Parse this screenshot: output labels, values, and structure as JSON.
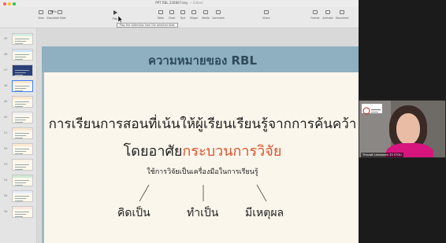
{
  "window": {
    "title": "PPT RBL 230807.key",
    "title_suffix": "— Edited"
  },
  "toolbar": {
    "buttons": [
      {
        "label": "View",
        "icon": "sidebar-icon"
      },
      {
        "label": "Zoom",
        "icon": "zoom-icon"
      },
      {
        "label": "Add Slide",
        "icon": "add-slide-icon"
      },
      {
        "label": "Play",
        "icon": "play-icon"
      },
      {
        "label": "Table",
        "icon": "table-icon"
      },
      {
        "label": "Chart",
        "icon": "chart-icon"
      },
      {
        "label": "Text",
        "icon": "text-icon"
      },
      {
        "label": "Shape",
        "icon": "shape-icon"
      },
      {
        "label": "Media",
        "icon": "media-icon"
      },
      {
        "label": "Comment",
        "icon": "comment-icon"
      },
      {
        "label": "Share",
        "icon": "share-icon"
      },
      {
        "label": "Format",
        "icon": "format-icon"
      },
      {
        "label": "Animate",
        "icon": "animate-icon"
      },
      {
        "label": "Document",
        "icon": "document-icon"
      }
    ],
    "zoom_value": "68%",
    "tooltip": "Play the slideshow from the selected slide."
  },
  "navigator": {
    "slide_numbers": [
      "45",
      "46",
      "47",
      "48",
      "49",
      "50",
      "51",
      "52",
      "53",
      "54",
      "55",
      "56"
    ]
  },
  "slide": {
    "title": "ความหมายของ RBL",
    "line1": "การเรียนการสอนที่เน้นให้ผู้เรียนเรียนรู้จากการค้นคว้า",
    "line2_prefix": "โดยอาศัย",
    "line2_highlight": "กระบวนการวิจัย",
    "line3": "ใช้การวิจัยเป็นเครื่องมือในการเรียนรู้",
    "outcomes": [
      "คิดเป็น",
      "ทำเป็น",
      "มีเหตุผล"
    ]
  },
  "video": {
    "participant_name": "Thavatt Leesasem 33 STOU"
  },
  "colors": {
    "slide_header": "#8eb0c0",
    "slide_title": "#2f4b5a",
    "highlight": "#d9542b",
    "slide_bg": "#fbf6ec",
    "shirt": "#d6157e"
  }
}
